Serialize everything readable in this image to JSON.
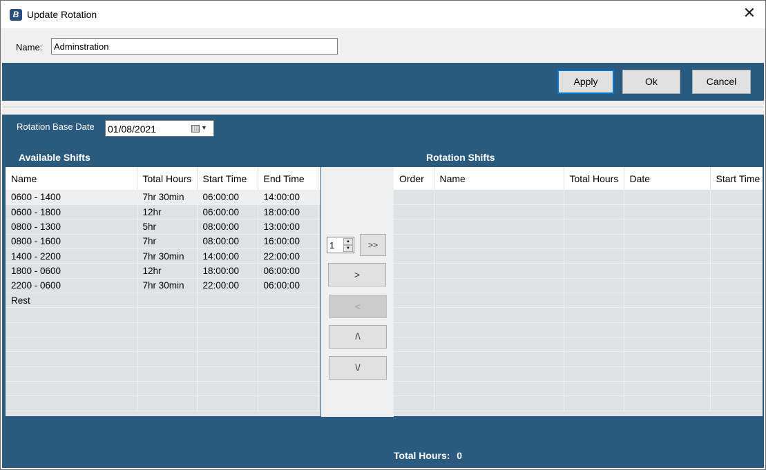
{
  "window": {
    "title": "Update Rotation",
    "close_glyph": "✕"
  },
  "name_field": {
    "label": "Name:",
    "value": "Adminstration"
  },
  "buttons": {
    "apply": "Apply",
    "ok": "Ok",
    "cancel": "Cancel"
  },
  "rotation_base_date": {
    "label": "Rotation Base Date",
    "value": "01/08/2021"
  },
  "available_shifts": {
    "title": "Available Shifts",
    "columns": [
      "Name",
      "Total Hours",
      "Start Time",
      "End Time"
    ],
    "rows": [
      [
        "0600 - 1400",
        "7hr 30min",
        "06:00:00",
        "14:00:00"
      ],
      [
        "0600 - 1800",
        "12hr",
        "06:00:00",
        "18:00:00"
      ],
      [
        "0800 - 1300",
        "5hr",
        "08:00:00",
        "13:00:00"
      ],
      [
        "0800 - 1600",
        "7hr",
        "08:00:00",
        "16:00:00"
      ],
      [
        "1400 - 2200",
        "7hr 30min",
        "14:00:00",
        "22:00:00"
      ],
      [
        "1800 - 0600",
        "12hr",
        "18:00:00",
        "06:00:00"
      ],
      [
        "2200 - 0600",
        "7hr 30min",
        "22:00:00",
        "06:00:00"
      ],
      [
        "Rest",
        "",
        "",
        ""
      ]
    ]
  },
  "controls": {
    "spinner_value": "1",
    "add_many": ">>",
    "add": ">",
    "remove": "<",
    "move_up": "/\\",
    "move_down": "\\/"
  },
  "rotation_shifts": {
    "title": "Rotation Shifts",
    "columns": [
      "Order",
      "Name",
      "Total Hours",
      "Date",
      "Start Time"
    ],
    "rows": []
  },
  "total_hours": {
    "label": "Total Hours:",
    "value": "0"
  }
}
